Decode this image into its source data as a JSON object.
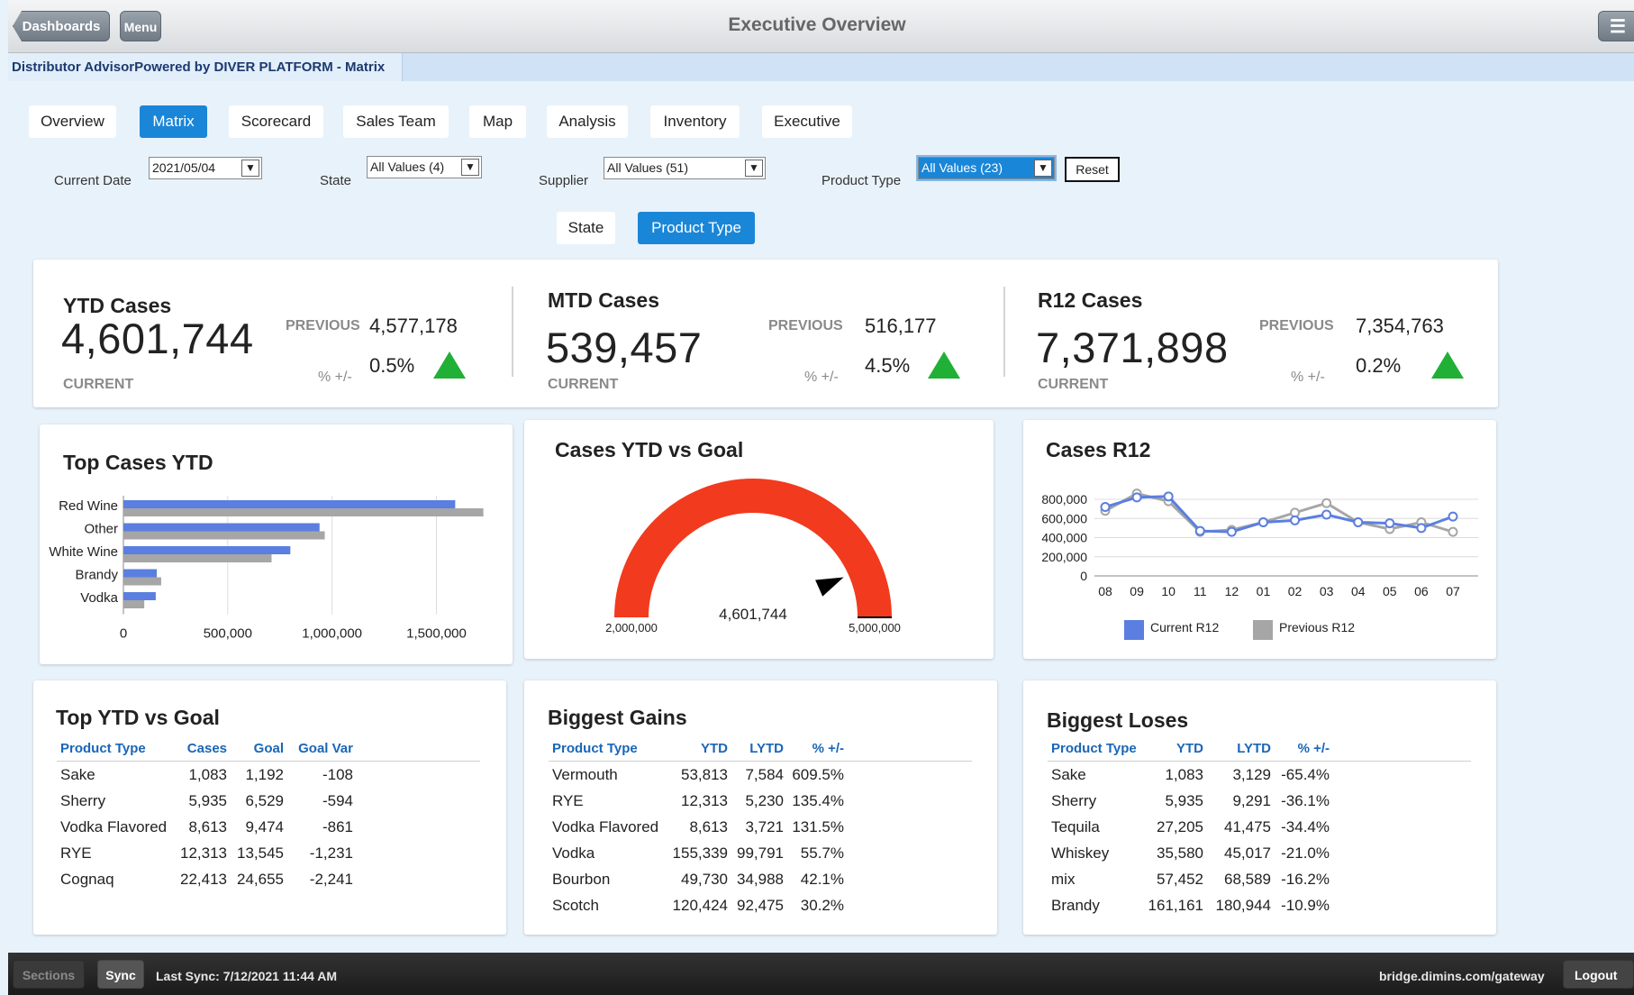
{
  "header": {
    "back_label": "Dashboards",
    "menu_label": "Menu",
    "title": "Executive Overview"
  },
  "subheader": {
    "brand": "Distributor AdvisorPowered by DIVER PLATFORM - Matrix"
  },
  "tabs": [
    "Overview",
    "Matrix",
    "Scorecard",
    "Sales Team",
    "Map",
    "Analysis",
    "Inventory",
    "Executive"
  ],
  "active_tab": "Matrix",
  "filters": {
    "current_date_label": "Current Date",
    "current_date": "2021/05/04",
    "state_label": "State",
    "state": "All Values (4)",
    "supplier_label": "Supplier",
    "supplier": "All Values (51)",
    "product_type_label": "Product Type",
    "product_type": "All Values (23)",
    "reset": "Reset"
  },
  "toggle": {
    "state": "State",
    "product_type": "Product Type",
    "active": "Product Type"
  },
  "kpis": {
    "ytd": {
      "title": "YTD Cases",
      "current": "4,601,744",
      "current_label": "CURRENT",
      "previous_label": "PREVIOUS",
      "previous": "4,577,178",
      "pct_label": "% +/-",
      "pct": "0.5%",
      "trend": "up"
    },
    "mtd": {
      "title": "MTD Cases",
      "current": "539,457",
      "current_label": "CURRENT",
      "previous_label": "PREVIOUS",
      "previous": "516,177",
      "pct_label": "% +/-",
      "pct": "4.5%",
      "trend": "up"
    },
    "r12": {
      "title": "R12 Cases",
      "current": "7,371,898",
      "current_label": "CURRENT",
      "previous_label": "PREVIOUS",
      "previous": "7,354,763",
      "pct_label": "% +/-",
      "pct": "0.2%",
      "trend": "up"
    }
  },
  "top_cases": {
    "title": "Top Cases YTD"
  },
  "gauge": {
    "title": "Cases YTD vs Goal",
    "min_label": "2,000,000",
    "max_label": "5,000,000",
    "value_label": "4,601,744",
    "min": 2000000,
    "max": 5000000,
    "value": 4601744,
    "color": "#f23a1e"
  },
  "r12chart": {
    "title": "Cases R12"
  },
  "chart_data": [
    {
      "type": "bar",
      "title": "Top Cases YTD",
      "categories": [
        "Red Wine",
        "Other",
        "White Wine",
        "Brandy",
        "Vodka"
      ],
      "series": [
        {
          "values": [
            1590000,
            940000,
            800000,
            160000,
            155000
          ],
          "color": "#5b7fe0"
        },
        {
          "values": [
            1725000,
            965000,
            710000,
            181000,
            100000
          ],
          "color": "#a6a6a6"
        }
      ],
      "xlim": [
        0,
        1800000
      ],
      "xticks": [
        "0",
        "500,000",
        "1,000,000",
        "1,500,000"
      ],
      "tick_values": [
        0,
        500000,
        1000000,
        1500000
      ],
      "grid": true
    },
    {
      "type": "line",
      "title": "Cases R12",
      "categories": [
        "08",
        "09",
        "10",
        "11",
        "12",
        "01",
        "02",
        "03",
        "04",
        "05",
        "06",
        "07"
      ],
      "series": [
        {
          "name": "Current R12",
          "values": [
            720000,
            820000,
            830000,
            470000,
            460000,
            560000,
            580000,
            640000,
            560000,
            550000,
            500000,
            620000
          ],
          "color": "#5b7fe0"
        },
        {
          "name": "Previous R12",
          "values": [
            680000,
            860000,
            780000,
            460000,
            480000,
            560000,
            660000,
            760000,
            560000,
            490000,
            560000,
            460000
          ],
          "color": "#a6a6a6"
        }
      ],
      "ylim": [
        0,
        900000
      ],
      "yticks": [
        "800,000",
        "600,000",
        "400,000",
        "200,000",
        "0"
      ],
      "ytick_values": [
        800000,
        600000,
        400000,
        200000,
        0
      ],
      "legend": "bottom",
      "grid": true
    }
  ],
  "top_ytd_goal": {
    "title": "Top YTD vs Goal",
    "headers": [
      "Product Type",
      "Cases",
      "Goal",
      "Goal Var"
    ],
    "rows": [
      [
        "Sake",
        "1,083",
        "1,192",
        "-108"
      ],
      [
        "Sherry",
        "5,935",
        "6,529",
        "-594"
      ],
      [
        "Vodka Flavored",
        "8,613",
        "9,474",
        "-861"
      ],
      [
        "RYE",
        "12,313",
        "13,545",
        "-1,231"
      ],
      [
        "Cognaq",
        "22,413",
        "24,655",
        "-2,241"
      ]
    ]
  },
  "biggest_gains": {
    "title": "Biggest Gains",
    "headers": [
      "Product Type",
      "YTD",
      "LYTD",
      "% +/-"
    ],
    "rows": [
      [
        "Vermouth",
        "53,813",
        "7,584",
        "609.5%"
      ],
      [
        "RYE",
        "12,313",
        "5,230",
        "135.4%"
      ],
      [
        "Vodka Flavored",
        "8,613",
        "3,721",
        "131.5%"
      ],
      [
        "Vodka",
        "155,339",
        "99,791",
        "55.7%"
      ],
      [
        "Bourbon",
        "49,730",
        "34,988",
        "42.1%"
      ],
      [
        "Scotch",
        "120,424",
        "92,475",
        "30.2%"
      ]
    ]
  },
  "biggest_loses": {
    "title": "Biggest Loses",
    "headers": [
      "Product Type",
      "YTD",
      "LYTD",
      "% +/-"
    ],
    "rows": [
      [
        "Sake",
        "1,083",
        "3,129",
        "-65.4%"
      ],
      [
        "Sherry",
        "5,935",
        "9,291",
        "-36.1%"
      ],
      [
        "Tequila",
        "27,205",
        "41,475",
        "-34.4%"
      ],
      [
        "Whiskey",
        "35,580",
        "45,017",
        "-21.0%"
      ],
      [
        "mix",
        "57,452",
        "68,589",
        "-16.2%"
      ],
      [
        "Brandy",
        "161,161",
        "180,944",
        "-10.9%"
      ]
    ]
  },
  "footer": {
    "sections": "Sections",
    "sync": "Sync",
    "last_sync": "Last Sync: 7/12/2021 11:44 AM",
    "gateway": "bridge.dimins.com/gateway",
    "logout": "Logout"
  }
}
